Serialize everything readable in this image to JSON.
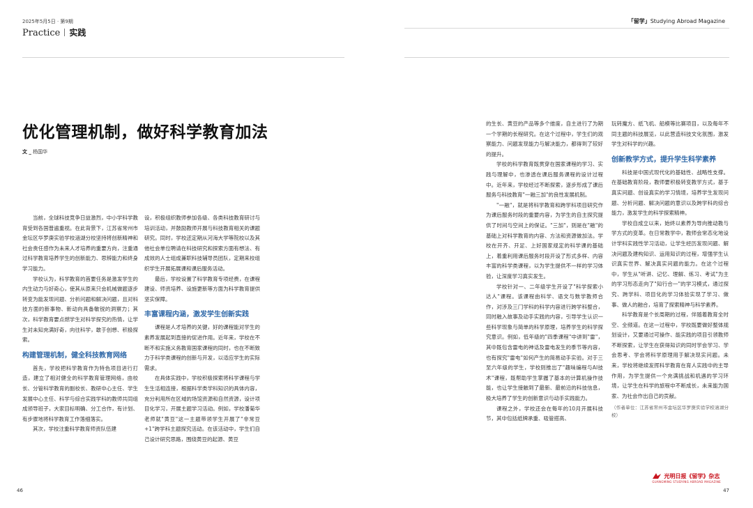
{
  "left_page": {
    "issue_date": "2025年5月5日 · 第9期",
    "section_label_en": "Practice",
    "section_label_cn": "实践",
    "page_number": "46"
  },
  "right_page": {
    "magazine_header_bold": "「留学」",
    "magazine_header_rest": "Studying Abroad Magazine",
    "page_number": "47",
    "footer_logo_text": "光明日报《留学》杂志",
    "footer_logo_sub": "GUANGMING STUDYING ABROAD MAGAZINE"
  },
  "article": {
    "title": "优化管理机制，做好科学教育加法",
    "byline_prefix": "文 _",
    "author": "杨国华",
    "columns": {
      "l1": {
        "p1": "当前，全球科技竞争日益激烈，中小学科学教育受到各国普遍重视。在此背景下，江苏省常州市金坛区华罗庚实验学校涵湖分校坚持将创新精神和社会责任感作为未来人才培养的重要方向，注重通过科学教育培养学生的创新能力、思辨能力和终身学习能力。",
        "p2": "学校认为，科学教育的首要任务是激发学生的内生动力与好奇心，使其从原来只会机械做题逐步转变为能发现问题、分析问题和解决问题，且对科技方面的新事物、新动向具备敏锐的洞察力；其次，科学教育要点燃学生对科学探究的热情，让学生对未知充满好奇，向往科学，敢于创想、积极探索。",
        "h1": "构建管理机制，健全科技教育网络",
        "p3": "首先，学校把科学教育作为特色项目进行打造，建立了相对健全的科学教育管理网络，由校长、分管科学教育的副校长、教研中心主任、学生发展中心主任、科学与综合实践学科的教师共同组成领导班子，大家目标明确、分工合作，有计划、有步骤地将科学教育工作落细落实。",
        "p4": "其次，学校注重科学教育师资队伍建"
      },
      "l2": {
        "p1": "设，积极组织教师参加各级、各类科技教育研讨与培训活动，并鼓励教师开展与科技教育相关的课题研究。同时，学校还定期从河海大学等院校以及其他社会单位聘请在科技研究和探索方面有想法、有成效的人士组成兼职科技辅导员团队，定期来校组织学生开展拓展课和课后服务活动。",
        "p2": "最后，学校设置了科学教育专项经费，在课程建设、师资培养、设施更新等方面为科学教育提供坚实保障。",
        "h1": "丰富课程内涵，激发学生创新实践",
        "p3": "课程是人才培养的关键，好的课程能对学生的素养发展起到直接的促进作用。近年来，学校在不断不和实施义务教育国家课程的同时，也在不断致力于科学类课程的创新与开发，以适应学生的实际需求。",
        "p4": "在具体实践中，学校积极探索将科学课程与学生生活相连接，根据科学类学科知识的具体内容，充分利用所在区域的场馆资源和自然资源，设计项目化学习，开展主题学习活动。例如，学校潘菊华老师就\"黄豆\"这一主题带领学生开展了\"非常豆+1\"跨学科主题探究活动。在该活动中，学生们自己设计研究思路，围绕黄豆的起源、黄豆"
      },
      "r1": {
        "p1": "的生长、黄豆的产品等多个维度，自主进行了为期一个学期的长程研究。在这个过程中，学生们的观察能力、问题发现能力与解决能力，都得到了较好的提升。",
        "p2": "学校的科学教育既贯穿在国家课程的学习、实践与理解中，也渗透在课后服务课程的设计过程中。近年来，学校经过不断探索，逐步形成了课后服务与科技教育\"一融三加\"的良性发展机制。",
        "p3": "\"一融\"，就是将科学教育和跨学科项目研究作为课后服务时段的重要内容，为学生的自主探究提供了时间与空间上的保证。\"三加\"，则是在\"融\"的基础上对科学教育的内容、方法和资源做加法。学校在开齐、开足、上好国家规定的科学课的基础上，着重利用课后服务时段开设了形式多样、内容丰富的科学类课程，以为学生提供不一样的学习体验，让深度学习真实发生。",
        "p4": "学校针对一、二年级学生开设了\"科学探索小达人\"课程。该课程由科学、语文与数学教师合作，对涉及三门学科的科学内容进行跨学科整合，同时融入故事及动手实践的内容，引导学生认识一些科学现象与简单的科学原理，培养学生的科学探究意识。例如，低年级的\"四季课程\"中讲到\"雷\"，其中既包含雷电的神话及雷电发生的季节等内容，也有探究\"雷电\"如何产生的简易动手实验。对于三至六年级的学生，学校则推出了\"趣味编程与AI技术\"课程，既帮助学生掌握了基本的计算机操作技能，也让学生接触到了最新、最前沿的科技信息，极大培养了学生的创新意识与动手实践能力。",
        "p5": "课程之外，学校还会在每年的10月开展科技节，其中包括纸牌承重、吸管搭高、"
      },
      "r2": {
        "p1": "玩转魔方、纸飞机、船模等比赛项目，以及每年不同主题的科技展览，以此营造科技文化氛围，激发学生对科学的兴趣。",
        "h1": "创新教学方式，提升学生科学素养",
        "p2": "科技是中国式现代化的基础性、战略性支撑。在基础教育阶段，教师要积极转变教学方式，基于真实问题、创设真实的学习情境，培养学生发现问题、分析问题、解决问题的意识以及跨学科的综合能力，激发学生的科学探索精神。",
        "p3": "学校自成立以来，始终以素养为导向推动教与学方式的变革。在日常教学中，教师会常态化地设计学科实践性学习活动，让学生经历发现问题、解决问题及建构知识、运用知识的过程，增强学生认识真实世界、解决真实问题的能力。在这个过程中，学生从\"听讲、记忆、理解、练习、考试\"为主的学习形态走向了\"知行合一\"的学习模式，通过探究、跨学科、项目化的学习体验实现了学习、做事、做人的融合，培育了探索精神与科学素养。",
        "p4": "科学教育是个长周期的过程，伴随着教育全时空、全频道。在这一过程中，学校既要做好整体规划设计，又要通过可操作、能实践的项目引领教师不断探索，让学生在获得知识的同时学会学习、学会思考、学会将科学原理用于解决现实问题。未来，学校将继续发挥科学教育在育人实践中的主导作用，为学生提供一个充满挑战和机遇的学习环境，让学生在科学的旅程中不断成长，未来能为国家、为社会作出自己的贡献。",
        "affiliation": "（作者单位：江苏省常州市金坛区华罗庚实验学校涵湖分校）"
      }
    }
  }
}
